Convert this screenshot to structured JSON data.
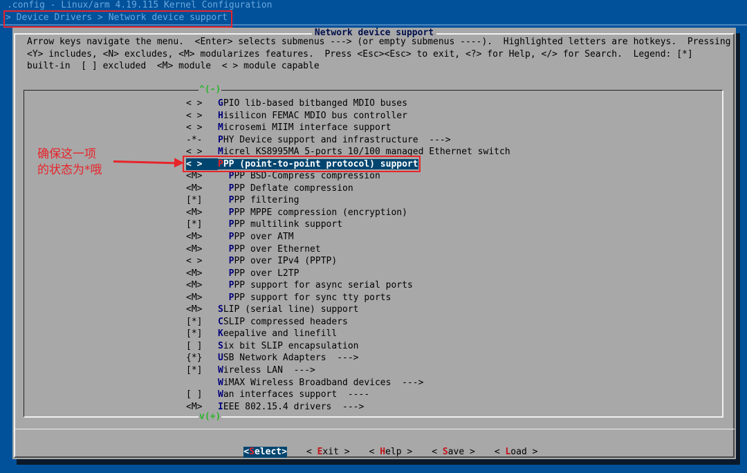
{
  "window": {
    "title": ".config - Linux/arm 4.19.115 Kernel Configuration",
    "breadcrumb": "> Device Drivers > Network device support"
  },
  "dialog": {
    "title": "Network device support",
    "help_line1": "Arrow keys navigate the menu.  <Enter> selects submenus ---> (or empty submenus ----).  Highlighted letters are hotkeys.  Pressing",
    "help_line2": "<Y> includes, <N> excludes, <M> modularizes features.  Press <Esc><Esc> to exit, <?> for Help, </> for Search.  Legend: [*]",
    "help_line3": "built-in  [ ] excluded  <M> module  < > module capable"
  },
  "menu": {
    "scroll_up": "^(-)",
    "scroll_down": "v(+)",
    "items": [
      {
        "mark": "< >",
        "hk": "G",
        "rest": "PIO lib-based bitbanged MDIO buses",
        "indent": ""
      },
      {
        "mark": "< >",
        "hk": "H",
        "rest": "isilicon FEMAC MDIO bus controller",
        "indent": ""
      },
      {
        "mark": "< >",
        "hk": "M",
        "rest": "icrosemi MIIM interface support",
        "indent": ""
      },
      {
        "mark": "-*-",
        "hk": "P",
        "rest": "HY Device support and infrastructure  --->",
        "indent": ""
      },
      {
        "mark": "< >",
        "hk": "M",
        "rest": "icrel KS8995MA 5-ports 10/100 managed Ethernet switch",
        "indent": ""
      },
      {
        "mark": "< >",
        "hk": "P",
        "rest": "PP (point-to-point protocol) support",
        "indent": "",
        "selected": true
      },
      {
        "mark": "<M>",
        "hk": "P",
        "rest": "PP BSD-Compress compression",
        "indent": "  "
      },
      {
        "mark": "<M>",
        "hk": "P",
        "rest": "PP Deflate compression",
        "indent": "  "
      },
      {
        "mark": "[*]",
        "hk": "P",
        "rest": "PP filtering",
        "indent": "  "
      },
      {
        "mark": "<M>",
        "hk": "P",
        "rest": "PP MPPE compression (encryption)",
        "indent": "  "
      },
      {
        "mark": "[*]",
        "hk": "P",
        "rest": "PP multilink support",
        "indent": "  "
      },
      {
        "mark": "<M>",
        "hk": "P",
        "rest": "PP over ATM",
        "indent": "  "
      },
      {
        "mark": "<M>",
        "hk": "P",
        "rest": "PP over Ethernet",
        "indent": "  "
      },
      {
        "mark": "< >",
        "hk": "P",
        "rest": "PP over IPv4 (PPTP)",
        "indent": "  "
      },
      {
        "mark": "<M>",
        "hk": "P",
        "rest": "PP over L2TP",
        "indent": "  "
      },
      {
        "mark": "<M>",
        "hk": "P",
        "rest": "PP support for async serial ports",
        "indent": "  "
      },
      {
        "mark": "<M>",
        "hk": "P",
        "rest": "PP support for sync tty ports",
        "indent": "  "
      },
      {
        "mark": "<M>",
        "hk": "S",
        "rest": "LIP (serial line) support",
        "indent": ""
      },
      {
        "mark": "[*]",
        "hk": "C",
        "rest": "SLIP compressed headers",
        "indent": ""
      },
      {
        "mark": "[*]",
        "hk": "K",
        "rest": "eepalive and linefill",
        "indent": ""
      },
      {
        "mark": "[ ]",
        "hk": "S",
        "rest": "ix bit SLIP encapsulation",
        "indent": ""
      },
      {
        "mark": "{*}",
        "hk": "U",
        "rest": "SB Network Adapters  --->",
        "indent": ""
      },
      {
        "mark": "[*]",
        "hk": "W",
        "rest": "ireless LAN  --->",
        "indent": ""
      },
      {
        "mark": "",
        "hk": "W",
        "rest": "iMAX Wireless Broadband devices  --->",
        "indent": ""
      },
      {
        "mark": "[ ]",
        "hk": "W",
        "rest": "an interfaces support  ----",
        "indent": ""
      },
      {
        "mark": "<M>",
        "hk": "I",
        "rest": "EEE 802.15.4 drivers  --->",
        "indent": ""
      }
    ]
  },
  "buttons": {
    "select": {
      "lt": "<",
      "hk": "S",
      "rest": "elect",
      "gt": ">"
    },
    "exit": {
      "lt": "< ",
      "hk": "E",
      "rest": "xit",
      "gt": " >"
    },
    "help": {
      "lt": "< ",
      "hk": "H",
      "rest": "elp",
      "gt": " >"
    },
    "save": {
      "lt": "< ",
      "hk": "S",
      "rest": "ave",
      "gt": " >"
    },
    "load": {
      "lt": "< ",
      "hk": "L",
      "rest": "oad",
      "gt": " >"
    }
  },
  "annotation": {
    "line1": "确保这一项",
    "line2": "的状态为*哦",
    "color": "#e8242a"
  }
}
